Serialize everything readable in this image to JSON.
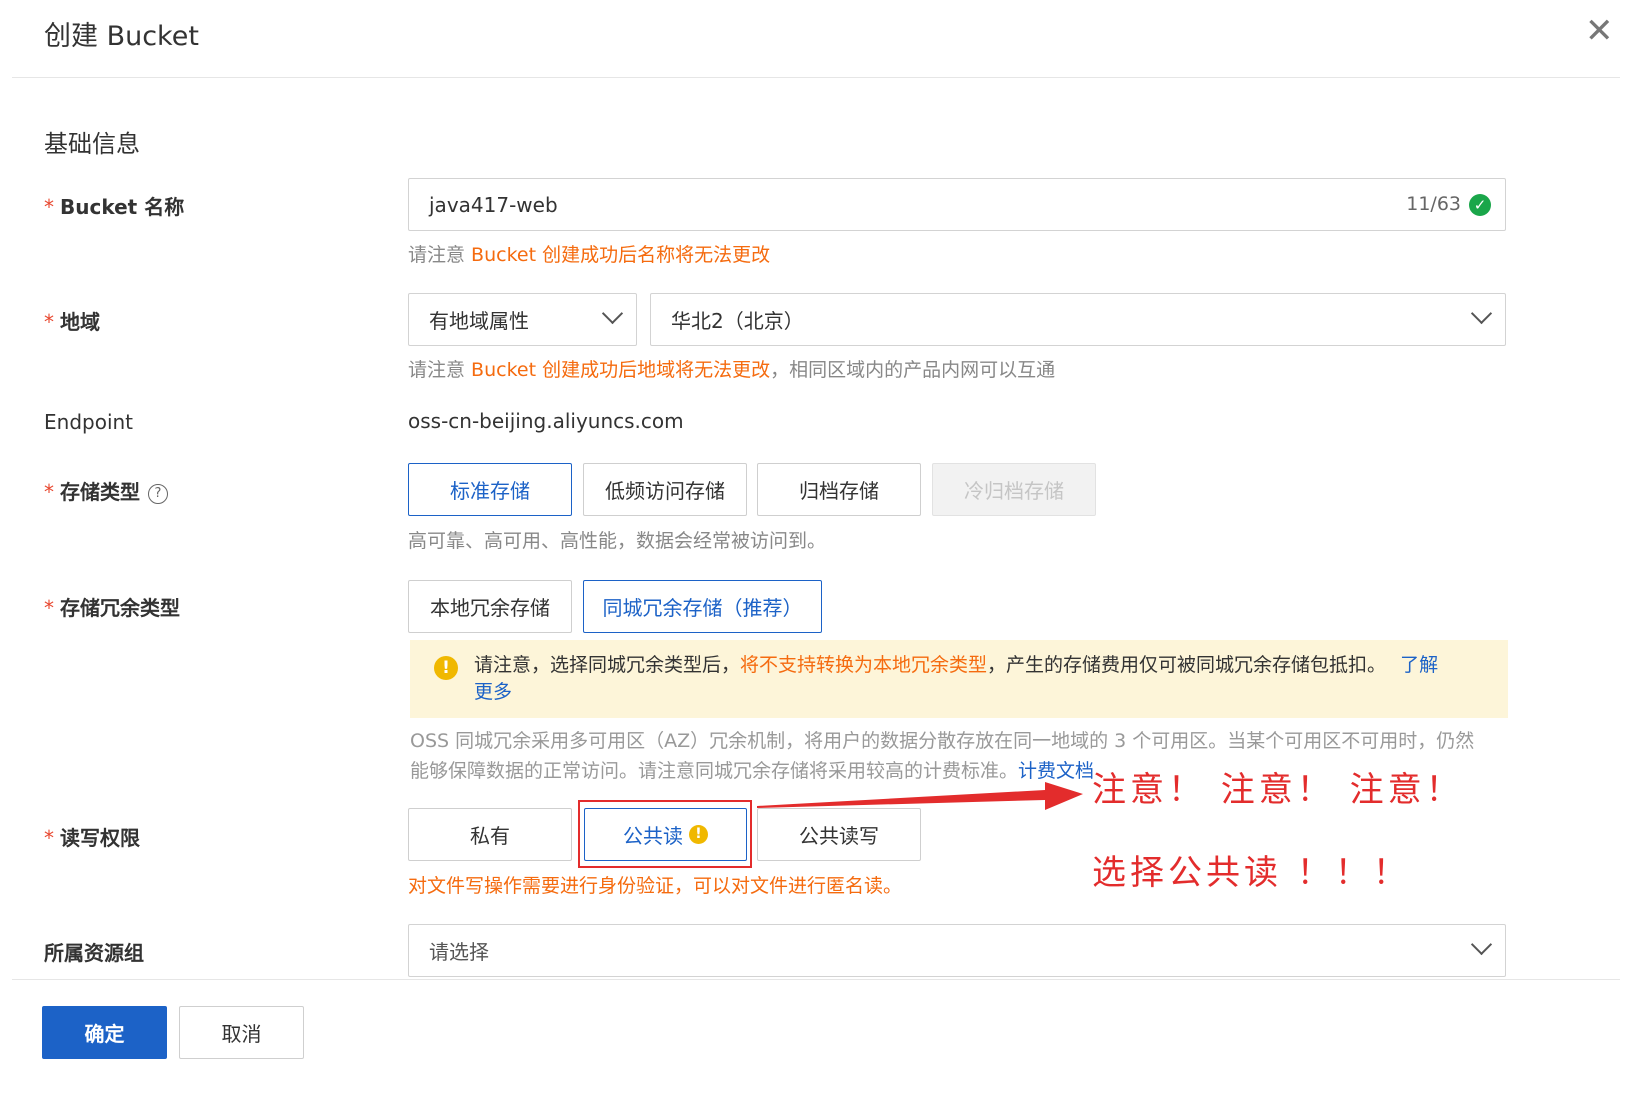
{
  "dialog": {
    "title": "创建 Bucket",
    "close_icon": "close-icon",
    "section_title": "基础信息"
  },
  "bucket_name": {
    "label": "Bucket 名称",
    "value": "java417-web",
    "counter": "11/63",
    "hint_prefix": "请注意 ",
    "hint_warn": "Bucket 创建成功后名称将无法更改"
  },
  "region": {
    "label": "地域",
    "type_value": "有地域属性",
    "region_value": "华北2（北京）",
    "hint_prefix": "请注意 ",
    "hint_warn": "Bucket 创建成功后地域将无法更改",
    "hint_suffix": "，相同区域内的产品内网可以互通"
  },
  "endpoint": {
    "label": "Endpoint",
    "value": "oss-cn-beijing.aliyuncs.com"
  },
  "storage_class": {
    "label": "存储类型",
    "options": [
      "标准存储",
      "低频访问存储",
      "归档存储",
      "冷归档存储"
    ],
    "selected": "标准存储",
    "hint": "高可靠、高可用、高性能，数据会经常被访问到。"
  },
  "redundancy": {
    "label": "存储冗余类型",
    "options": [
      "本地冗余存储",
      "同城冗余存储（推荐）"
    ],
    "selected": "同城冗余存储（推荐）",
    "alert_prefix": "请注意，选择同城冗余类型后，",
    "alert_warn": "将不支持转换为本地冗余类型",
    "alert_suffix": "，产生的存储费用仅可被同城冗余存储包抵扣。",
    "alert_link_1": "了解",
    "alert_link_2": "更多",
    "desc_line1": "OSS 同城冗余采用多可用区（AZ）冗余机制，将用户的数据分散存放在同一地域的 3 个可用区。当某个可用区不可用时，仍然",
    "desc_line2": "能够保障数据的正常访问。请注意同城冗余存储将采用较高的计费标准。",
    "desc_link": "计费文档"
  },
  "acl": {
    "label": "读写权限",
    "options": [
      "私有",
      "公共读",
      "公共读写"
    ],
    "selected": "公共读",
    "hint": "对文件写操作需要进行身份验证，可以对文件进行匿名读。"
  },
  "resource_group": {
    "label": "所属资源组",
    "placeholder": "请选择"
  },
  "annotation": {
    "line1": "注意！ 注意！ 注意！",
    "line2": "选择公共读 ！！！",
    "color": "#e32c2c"
  },
  "footer": {
    "confirm": "确定",
    "cancel": "取消"
  },
  "colors": {
    "primary": "#1c62c7",
    "warning": "#f56b0f",
    "success": "#1aa64a",
    "alert_bg": "#fdf5d9"
  }
}
